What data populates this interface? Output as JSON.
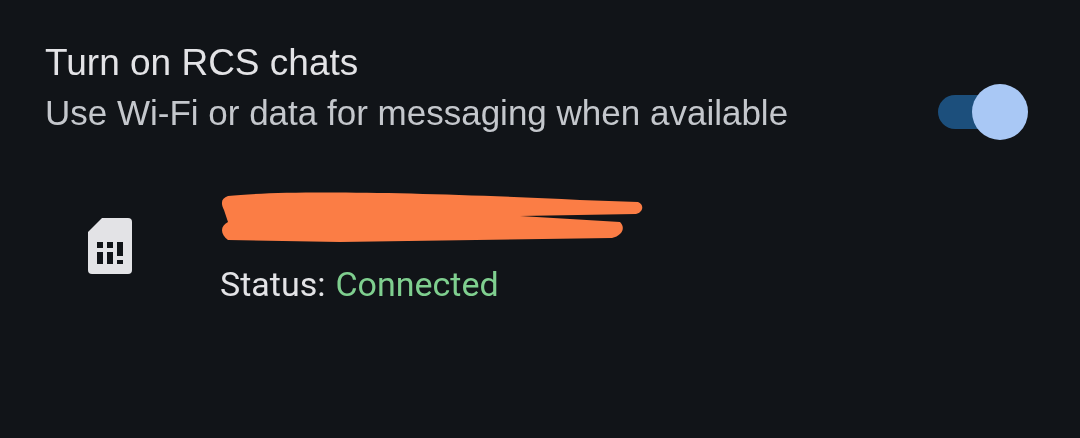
{
  "rcs_setting": {
    "title": "Turn on RCS chats",
    "description": "Use Wi-Fi or data for messaging when available",
    "on": true
  },
  "sim": {
    "status_label": "Status:",
    "status_value": "Connected"
  }
}
